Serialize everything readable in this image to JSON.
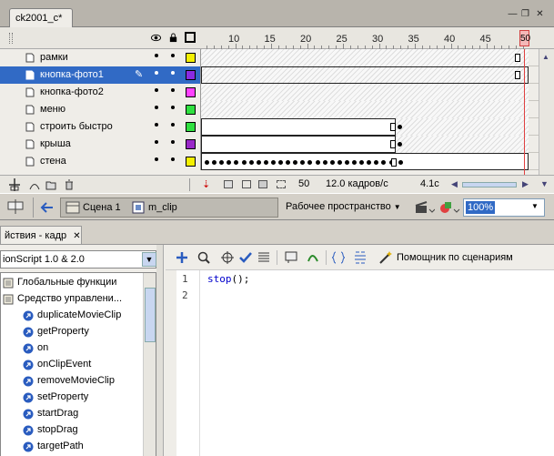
{
  "document_tab": {
    "title": "ck2001_c*"
  },
  "window_controls": [
    "—",
    "❐",
    "✕"
  ],
  "timeline": {
    "ruler_ticks": [
      "10",
      "15",
      "20",
      "25",
      "30",
      "35",
      "40",
      "45"
    ],
    "current_frame": "50",
    "layers": [
      {
        "name": "рамки",
        "color": "#f4f000",
        "selected": false,
        "pencil": false
      },
      {
        "name": "кнопка-фото1",
        "color": "#8a2be2",
        "selected": true,
        "pencil": true
      },
      {
        "name": "кнопка-фото2",
        "color": "#ff40ff",
        "selected": false,
        "pencil": false
      },
      {
        "name": "меню",
        "color": "#30e040",
        "selected": false,
        "pencil": false
      },
      {
        "name": "строить быстро",
        "color": "#30e040",
        "selected": false,
        "pencil": false
      },
      {
        "name": "крыша",
        "color": "#9a28c8",
        "selected": false,
        "pencil": false
      },
      {
        "name": "стена",
        "color": "#f4f000",
        "selected": false,
        "pencil": false
      }
    ],
    "footer": {
      "frame": "50",
      "fps": "12.0 кадров/с",
      "time": "4.1с"
    }
  },
  "editbar": {
    "scene": "Сцена 1",
    "symbol": "m_clip",
    "workspace": "Рабочее пространство",
    "zoom": "100%"
  },
  "actions": {
    "tab_title": "йствия - кадр",
    "version_select": "ionScript 1.0 & 2.0",
    "tree": [
      {
        "label": "Глобальные функции",
        "level": 0,
        "icon": "book-icon"
      },
      {
        "label": "Средство управлени...",
        "level": 0,
        "icon": "book-icon"
      },
      {
        "label": "duplicateMovieClip",
        "level": 1,
        "icon": "action-icon"
      },
      {
        "label": "getProperty",
        "level": 1,
        "icon": "action-icon"
      },
      {
        "label": "on",
        "level": 1,
        "icon": "action-icon"
      },
      {
        "label": "onClipEvent",
        "level": 1,
        "icon": "action-icon"
      },
      {
        "label": "removeMovieClip",
        "level": 1,
        "icon": "action-icon"
      },
      {
        "label": "setProperty",
        "level": 1,
        "icon": "action-icon"
      },
      {
        "label": "startDrag",
        "level": 1,
        "icon": "action-icon"
      },
      {
        "label": "stopDrag",
        "level": 1,
        "icon": "action-icon"
      },
      {
        "label": "targetPath",
        "level": 1,
        "icon": "action-icon"
      }
    ],
    "script_helper": "Помощник по сценариям",
    "line_numbers": [
      "1",
      "2"
    ],
    "code": {
      "keyword": "stop",
      "rest": "();"
    }
  }
}
